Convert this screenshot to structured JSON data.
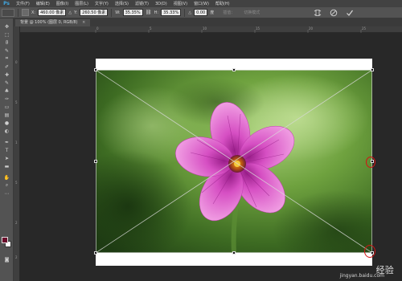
{
  "app": {
    "logo": "Ps"
  },
  "menu": [
    "文件(F)",
    "编辑(E)",
    "图像(I)",
    "图层(L)",
    "文字(Y)",
    "选择(S)",
    "滤镜(T)",
    "3D(D)",
    "视图(V)",
    "窗口(W)",
    "帮助(H)"
  ],
  "options": {
    "x_label": "X:",
    "x_value": "460.00 像素",
    "y_label": "Y:",
    "y_value": "260.50 像素",
    "w_label": "W:",
    "w_value": "35.35%",
    "h_label": "H:",
    "h_value": "35.33%",
    "angle_label": "△",
    "angle_value": "0.00",
    "angle_unit": "度",
    "interp_label": "插值：",
    "mode_toggle": "切换模式"
  },
  "document": {
    "tab_title": "背景 @ 100% (图层 0, RGB/8)",
    "tab_close": "×"
  },
  "ruler": {
    "top_ticks": [
      "0",
      "5",
      "10",
      "15",
      "20",
      "25"
    ],
    "left_ticks": [
      "0",
      "5",
      "1",
      "5",
      "2",
      "2"
    ]
  },
  "colors": {
    "foreground": "#6b0d2b",
    "background": "#ffffff",
    "annotation": "#d31414"
  },
  "watermark": {
    "text": "经验",
    "site": "jingyan.baidu.com"
  },
  "icons": {
    "warp": "warp-icon",
    "cancel": "cancel-icon",
    "commit": "commit-icon"
  }
}
